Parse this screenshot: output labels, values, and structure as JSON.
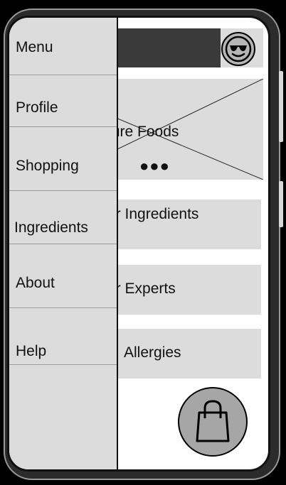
{
  "drawer": {
    "items": [
      {
        "label": "Menu"
      },
      {
        "label": "Profile"
      },
      {
        "label": "Shopping"
      },
      {
        "label": "Ingredients"
      },
      {
        "label": "About"
      },
      {
        "label": "Help"
      }
    ]
  },
  "header": {
    "avatar_icon": "sunglasses-smiley-icon"
  },
  "hero": {
    "title": "ture Foods",
    "dots": "●●●",
    "image_icon": "image-placeholder-icon"
  },
  "cards": [
    {
      "label": "ur Ingredients"
    },
    {
      "label": "ur Experts"
    },
    {
      "label": "Allergies"
    }
  ],
  "cart": {
    "icon": "shopping-bag-icon"
  }
}
